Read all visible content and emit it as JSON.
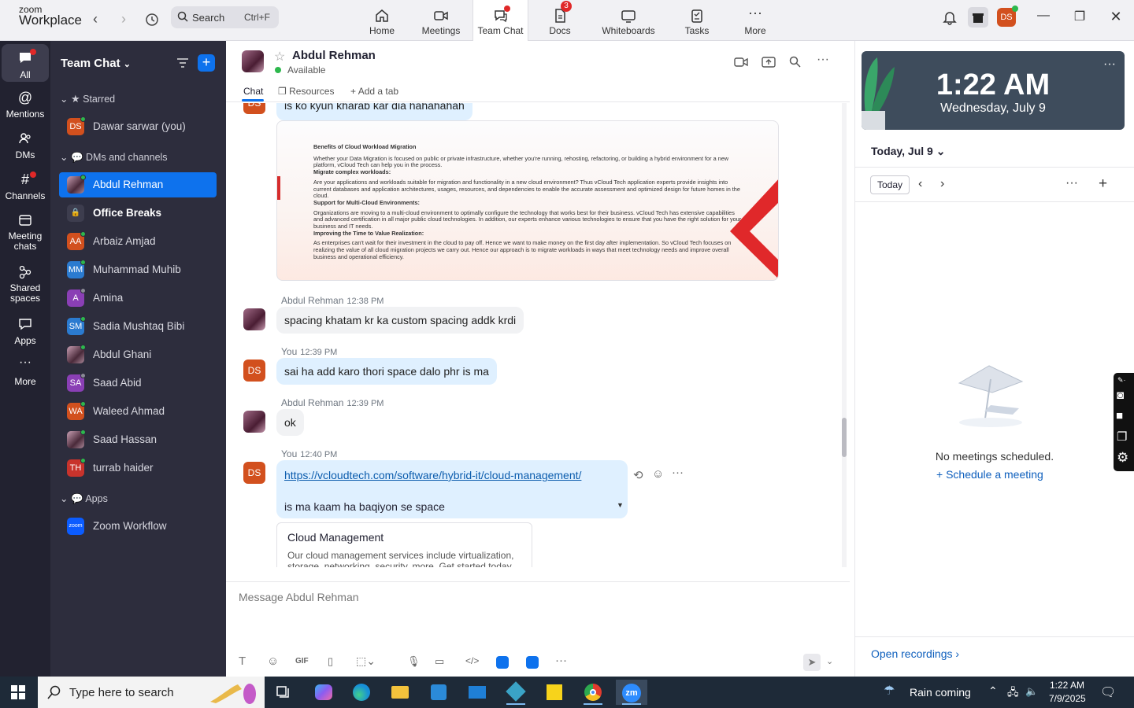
{
  "app": {
    "logo_top": "zoom",
    "logo_bottom": "Workplace"
  },
  "search": {
    "label": "Search",
    "shortcut": "Ctrl+F"
  },
  "nav_tabs": [
    {
      "label": "Home"
    },
    {
      "label": "Meetings"
    },
    {
      "label": "Team Chat"
    },
    {
      "label": "Docs",
      "badge": "3"
    },
    {
      "label": "Whiteboards"
    },
    {
      "label": "Tasks"
    },
    {
      "label": "More"
    }
  ],
  "user_avatar": "DS",
  "rail": [
    {
      "label": "All"
    },
    {
      "label": "Mentions"
    },
    {
      "label": "DMs"
    },
    {
      "label": "Channels"
    },
    {
      "label": "Meeting chats"
    },
    {
      "label": "Shared spaces"
    },
    {
      "label": "Apps"
    },
    {
      "label": "More"
    }
  ],
  "sidebar": {
    "title": "Team Chat",
    "starred_label": "Starred",
    "dms_label": "DMs and channels",
    "apps_label": "Apps",
    "starred": [
      {
        "initials": "DS",
        "name": "Dawar sarwar (you)",
        "color": "#d2501e"
      }
    ],
    "dms": [
      {
        "initials": "",
        "name": "Abdul Rehman"
      },
      {
        "initials": "",
        "name": "Office Breaks"
      },
      {
        "initials": "AA",
        "name": "Arbaiz Amjad",
        "color": "#d2501e"
      },
      {
        "initials": "MM",
        "name": "Muhammad Muhib",
        "color": "#2b7bd0"
      },
      {
        "initials": "A",
        "name": "Amina",
        "color": "#8a3fb5"
      },
      {
        "initials": "SM",
        "name": "Sadia Mushtaq Bibi",
        "color": "#2b7bd0"
      },
      {
        "initials": "",
        "name": "Abdul Ghani"
      },
      {
        "initials": "SA",
        "name": "Saad Abid",
        "color": "#8a3fb5"
      },
      {
        "initials": "WA",
        "name": "Waleed Ahmad",
        "color": "#d2501e"
      },
      {
        "initials": "",
        "name": "Saad Hassan"
      },
      {
        "initials": "TH",
        "name": "turrab haider",
        "color": "#c8332c"
      }
    ],
    "apps": [
      {
        "initials": "zoom",
        "name": "Zoom Workflow"
      }
    ]
  },
  "chat": {
    "contact": "Abdul Rehman",
    "status": "Available",
    "tabs": [
      "Chat",
      "Resources",
      "Add a tab"
    ],
    "cut_text": "is ko kyun kharab kar dia hahahahah",
    "image_doc": {
      "title": "Benefits of Cloud Workload Migration",
      "p1": "Whether your Data Migration is focused on public or private infrastructure, whether you're running, rehosting, refactoring, or building a hybrid environment for a new platform, vCloud Tech can help you in the process.",
      "h2": "Migrate complex workloads:",
      "p2": "Are your applications and workloads suitable for migration and functionality in a new cloud environment? Thus vCloud Tech application experts provide insights into current databases and application architectures, usages, resources, and dependencies to enable the accurate assessment and optimized design for future homes in the cloud.",
      "h3": "Support for Multi-Cloud Environments:",
      "p3": "Organizations are moving to a multi-cloud environment to optimally configure the technology that works best for their business. vCloud Tech has extensive capabilities and advanced certification in all major public cloud technologies. In addition, our experts enhance various technologies to ensure that you have the right solution for your business and IT needs.",
      "h4": "Improving the Time to Value Realization:",
      "p4": "As enterprises can't wait for their investment in the cloud to pay off. Hence we want to make money on the first day after implementation. So vCloud Tech focuses on realizing the value of all cloud migration projects we carry out. Hence our approach is to migrate workloads in ways that meet technology needs and improve overall business and operational efficiency."
    },
    "messages": [
      {
        "sender": "Abdul Rehman",
        "time": "12:38 PM",
        "text": "spacing khatam kr ka custom spacing addk krdi"
      },
      {
        "sender": "You",
        "time": "12:39 PM",
        "text": "sai ha add karo thori space dalo phr is ma"
      },
      {
        "sender": "Abdul Rehman",
        "time": "12:39 PM",
        "text": "ok"
      },
      {
        "sender": "You",
        "time": "12:40 PM",
        "link": "https://vcloudtech.com/software/hybrid-it/cloud-management/",
        "text": "is ma kaam ha baqiyon se space"
      }
    ],
    "link_preview": {
      "title": "Cloud Management",
      "desc": "Our cloud management services include virtualization, storage, networking, security, more. Get started today."
    },
    "composer_placeholder": "Message Abdul Rehman"
  },
  "calendar": {
    "time": "1:22 AM",
    "date": "Wednesday, July 9",
    "day_selector": "Today, Jul 9",
    "today_btn": "Today",
    "empty": "No meetings scheduled.",
    "schedule": "Schedule a meeting",
    "recordings": "Open recordings"
  },
  "taskbar": {
    "search_placeholder": "Type here to search",
    "weather": "Rain coming",
    "time": "1:22 AM",
    "date": "7/9/2025"
  }
}
